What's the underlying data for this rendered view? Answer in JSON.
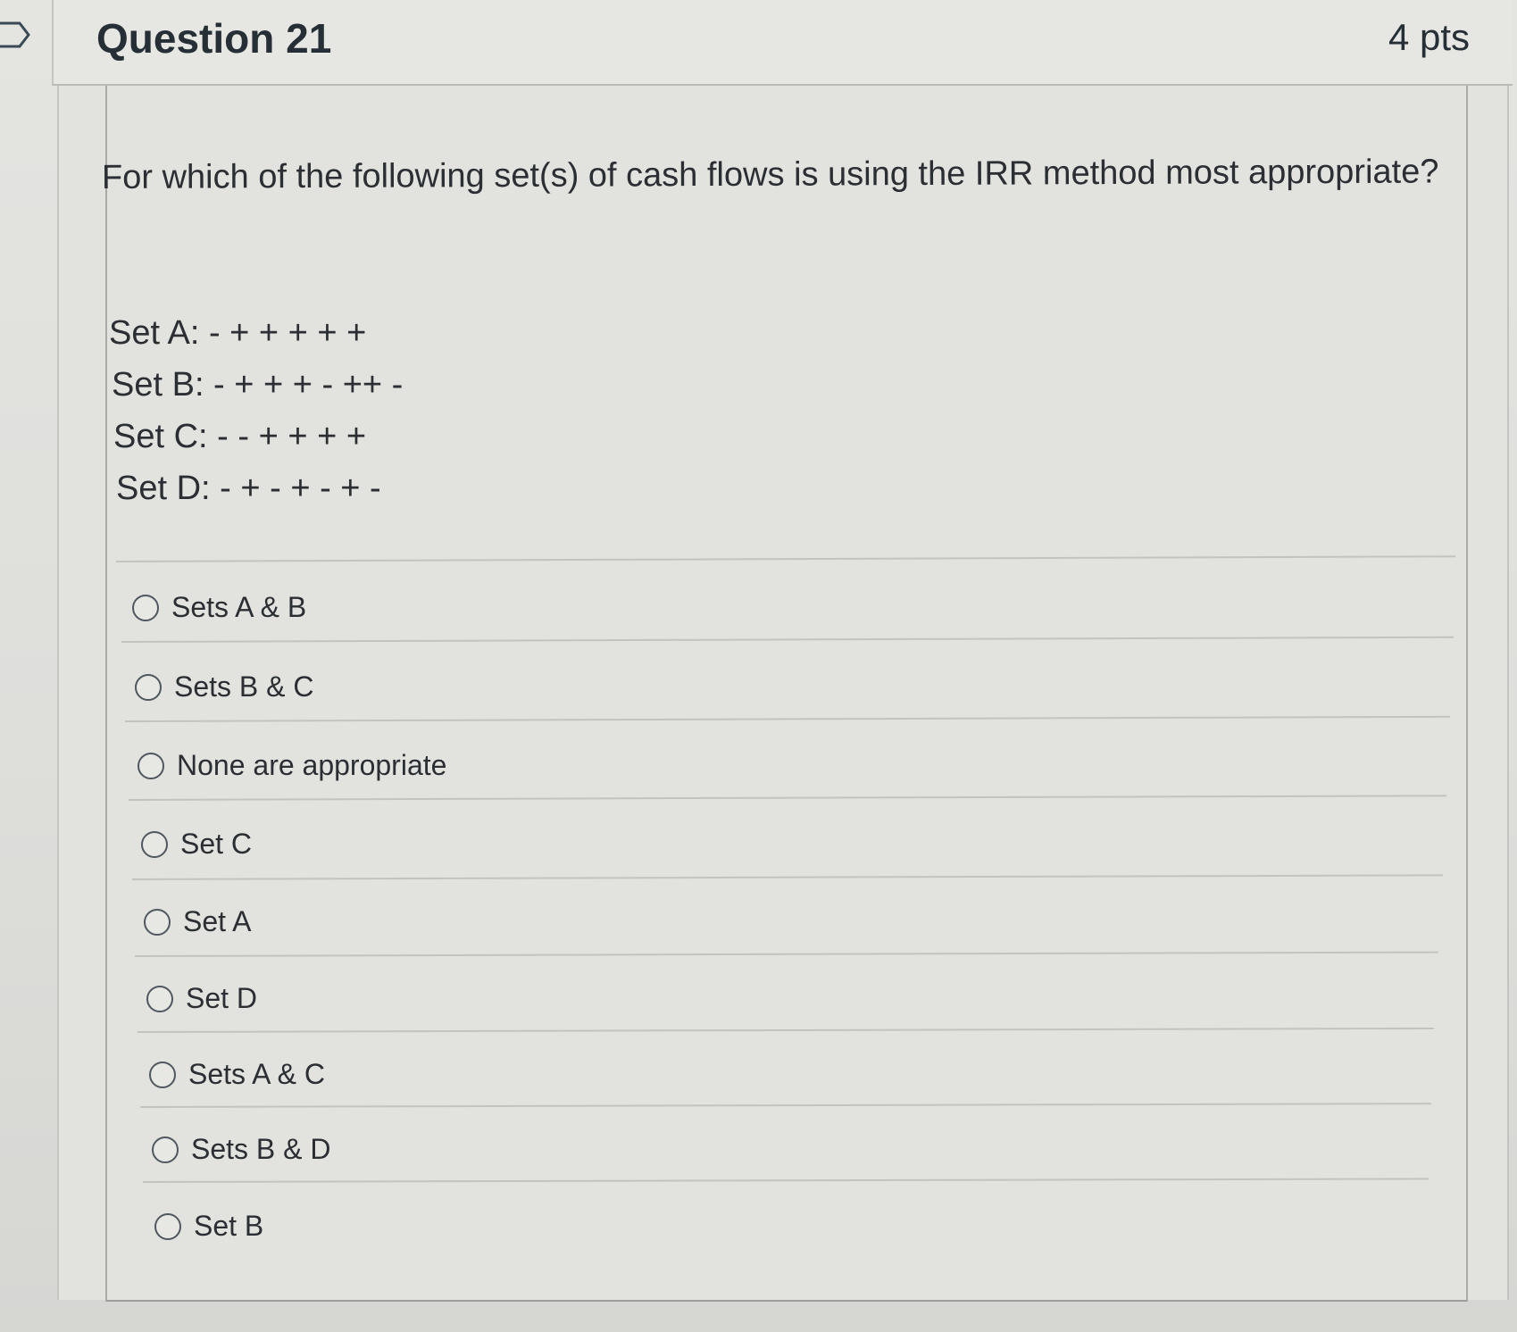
{
  "question": {
    "title": "Question 21",
    "points": "4 pts",
    "prompt": "For which of the following set(s) of cash flows is using the IRR method most appropriate?",
    "sets": [
      "Set A: - + + + + +",
      "Set B: - + + + - ++ -",
      "Set C: - - + + + +",
      "Set D: - + - + - + -"
    ]
  },
  "answers": [
    {
      "label": "Sets A & B",
      "selected": false
    },
    {
      "label": "Sets B & C",
      "selected": false
    },
    {
      "label": "None are appropriate",
      "selected": false
    },
    {
      "label": "Set C",
      "selected": false
    },
    {
      "label": "Set A",
      "selected": false
    },
    {
      "label": "Set D",
      "selected": false
    },
    {
      "label": "Sets A & C",
      "selected": false
    },
    {
      "label": "Sets B & D",
      "selected": false
    },
    {
      "label": "Set B",
      "selected": false
    }
  ]
}
